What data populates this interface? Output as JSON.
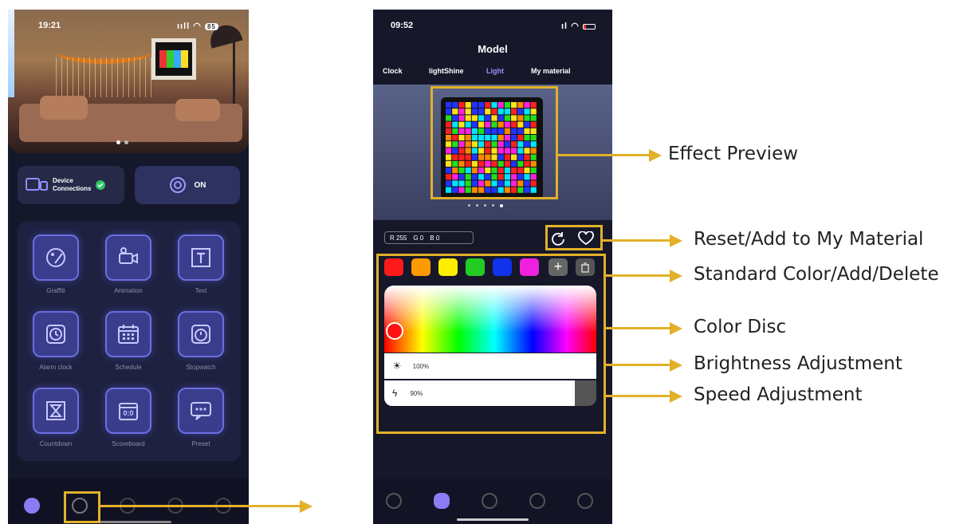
{
  "phone1": {
    "time": "19:21",
    "battery": "85",
    "device_connections": "Device\nConnections",
    "power_label": "ON",
    "tiles": [
      {
        "label": "Graffiti",
        "icon": "palette-icon"
      },
      {
        "label": "Animation",
        "icon": "video-camera-icon"
      },
      {
        "label": "Text",
        "icon": "text-icon"
      },
      {
        "label": "Alarm clock",
        "icon": "alarm-clock-icon"
      },
      {
        "label": "Schedule",
        "icon": "calendar-icon"
      },
      {
        "label": "Stopwatch",
        "icon": "stopwatch-icon"
      },
      {
        "label": "Countdown",
        "icon": "hourglass-icon"
      },
      {
        "label": "Scoreboard",
        "icon": "scoreboard-icon"
      },
      {
        "label": "Preset",
        "icon": "chat-bubble-icon"
      }
    ],
    "scoreboard_text": "0:0"
  },
  "phone2": {
    "time": "09:52",
    "title": "Model",
    "tabs": [
      "Clock",
      "lightShine",
      "Light",
      "My material"
    ],
    "active_tab": "Light",
    "rgb": {
      "r": "R 255",
      "g": "G 0",
      "b": "B 0"
    },
    "swatches": [
      "#ff1a1a",
      "#ff9900",
      "#ffee00",
      "#22cc22",
      "#1133ee",
      "#ee22dd"
    ],
    "brightness": "100%",
    "speed": "90%",
    "speed_fraction": 0.9
  },
  "callouts": {
    "effect_preview": "Effect Preview",
    "reset_add": "Reset/Add to My Material",
    "standard_color": "Standard Color/Add/Delete",
    "color_disc": "Color Disc",
    "brightness": "Brightness Adjustment",
    "speed": "Speed Adjustment"
  },
  "colors": {
    "accent": "#e2b12a"
  }
}
